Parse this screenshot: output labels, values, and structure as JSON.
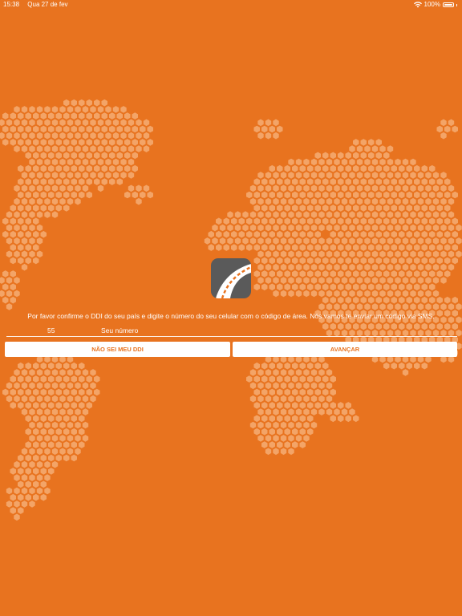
{
  "status_bar": {
    "time": "15:38",
    "date": "Qua 27 de fev",
    "battery": "100%",
    "icons": [
      "wifi-icon",
      "battery-icon"
    ]
  },
  "background": {
    "color": "#E8731F",
    "pattern": "world-map-hexagon-dots",
    "dot_color": "#F3A467"
  },
  "logo": {
    "icon": "road-icon",
    "colors": {
      "tile": "#5a5a5a",
      "road": "#ffffff",
      "stripe": "#E8731F"
    }
  },
  "form": {
    "instruction": "Por favor confirme o DDI do seu país e digite o número do seu celular com o código de área. Nós vamos te enviar um código via SMS.",
    "ddi_value": "55",
    "number_placeholder": "Seu número"
  },
  "buttons": {
    "unknown_ddi": "NÃO SEI MEU DDI",
    "next": "AVANÇAR"
  }
}
